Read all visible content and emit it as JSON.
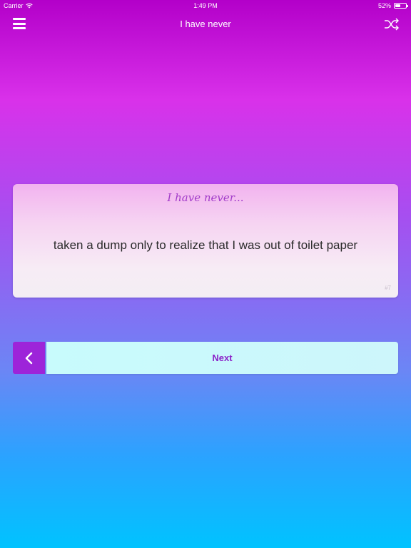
{
  "status_bar": {
    "carrier": "Carrier",
    "time": "1:49 PM",
    "battery": "52%",
    "battery_level": 0.52
  },
  "nav": {
    "title": "I have never",
    "menu_icon": "hamburger-menu-icon",
    "shuffle_icon": "shuffle-icon"
  },
  "card": {
    "heading": "I have never...",
    "statement": "taken a dump only to realize that I was out of toilet paper",
    "number": "#7"
  },
  "controls": {
    "back_icon": "chevron-left-icon",
    "next_label": "Next"
  },
  "colors": {
    "accent_purple": "#9d24d9",
    "next_text": "#8b1fc8",
    "heading_text": "#a23cc9"
  }
}
